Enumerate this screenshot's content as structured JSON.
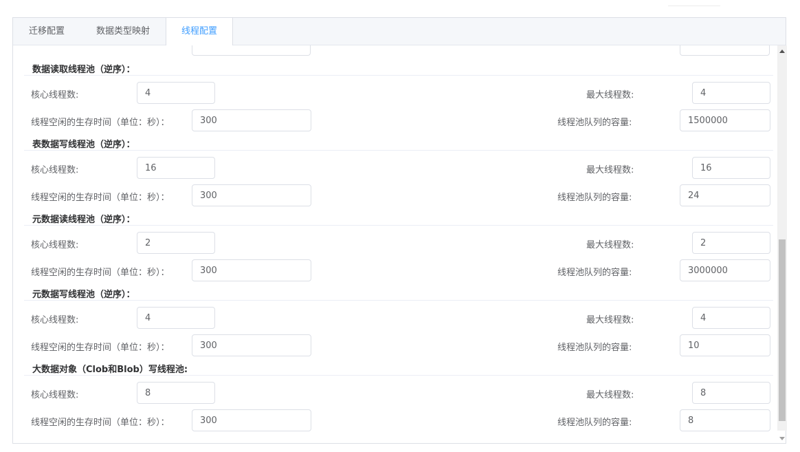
{
  "tabs": [
    {
      "label": "迁移配置",
      "active": false
    },
    {
      "label": "数据类型映射",
      "active": false
    },
    {
      "label": "线程配置",
      "active": true
    }
  ],
  "labels": {
    "core_threads": "核心线程数:",
    "max_threads": "最大线程数:",
    "keep_alive": "线程空闲的生存时间（单位：秒）：",
    "queue_capacity": "线程池队列的容量:"
  },
  "sections": [
    {
      "title": "数据读取线程池（逆序）：",
      "core": "4",
      "max": "4",
      "keep_alive": "300",
      "queue": "1500000"
    },
    {
      "title": "表数据写线程池（逆序）：",
      "core": "16",
      "max": "16",
      "keep_alive": "300",
      "queue": "24"
    },
    {
      "title": "元数据读线程池（逆序）：",
      "core": "2",
      "max": "2",
      "keep_alive": "300",
      "queue": "3000000"
    },
    {
      "title": "元数据写线程池（逆序）：",
      "core": "4",
      "max": "4",
      "keep_alive": "300",
      "queue": "10"
    },
    {
      "title": "大数据对象（Clob和Blob）写线程池:",
      "core": "8",
      "max": "8",
      "keep_alive": "300",
      "queue": "8"
    }
  ],
  "colors": {
    "accent": "#409eff",
    "border": "#dcdfe6",
    "text": "#606266"
  },
  "icons": {
    "scroll_up": "scroll-up-arrow-icon",
    "scroll_down": "scroll-down-arrow-icon"
  }
}
